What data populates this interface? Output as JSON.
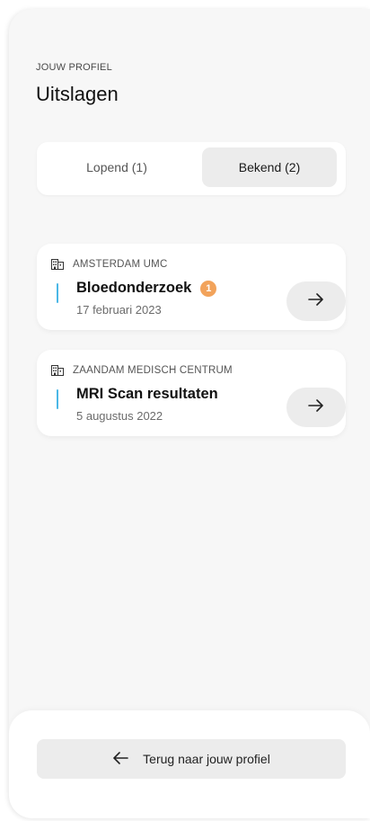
{
  "header": {
    "eyebrow": "JOUW PROFIEL",
    "title": "Uitslagen"
  },
  "tabs": [
    {
      "label": "Lopend (1)",
      "selected": false
    },
    {
      "label": "Bekend (2)",
      "selected": true
    }
  ],
  "results": [
    {
      "organization": "AMSTERDAM UMC",
      "title": "Bloedonderzoek",
      "badge": "1",
      "date": "17 februari 2023",
      "icon": "building-icon",
      "action_icon": "arrow-right-icon"
    },
    {
      "organization": "ZAANDAM MEDISCH CENTRUM",
      "title": "MRI Scan resultaten",
      "date": "5 augustus 2022",
      "icon": "building-icon",
      "action_icon": "arrow-right-icon"
    }
  ],
  "footer": {
    "back_label": "Terug naar jouw profiel",
    "back_icon": "arrow-left-icon"
  },
  "colors": {
    "accent": "#4ab7e6",
    "badge": "#f2a35b",
    "surface": "#f7f7f7",
    "button": "#ececec"
  }
}
